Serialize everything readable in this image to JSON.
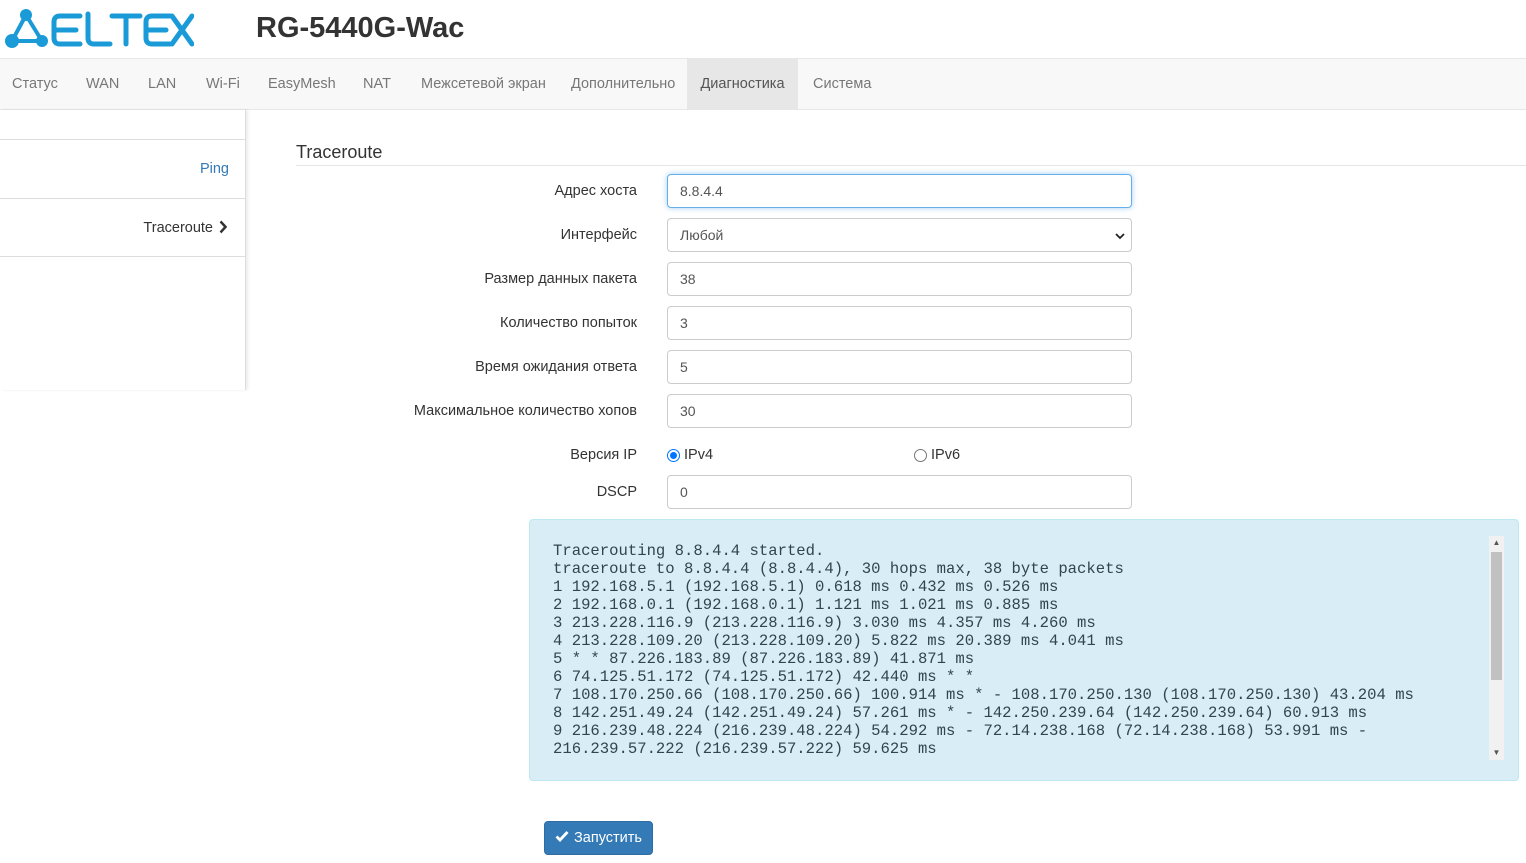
{
  "header": {
    "logo_text": "ELTEX",
    "model": "RG-5440G-Wac"
  },
  "nav": {
    "items": [
      "Статус",
      "WAN",
      "LAN",
      "Wi-Fi",
      "EasyMesh",
      "NAT",
      "Межсетевой экран",
      "Дополнительно",
      "Диагностика",
      "Система"
    ],
    "active": "Диагностика"
  },
  "side": {
    "items": [
      {
        "label": "Ping"
      },
      {
        "label": "Traceroute"
      }
    ],
    "current": "Traceroute",
    "current_icon": "chevron-right-icon"
  },
  "form": {
    "title": "Traceroute",
    "host_label": "Адрес хоста",
    "host_value": "8.8.4.4",
    "interface_label": "Интерфейс",
    "interface_value": "Любой",
    "packet_size_label": "Размер данных пакета",
    "packet_size_value": "38",
    "attempts_label": "Количество попыток",
    "attempts_value": "3",
    "timeout_label": "Время ожидания ответа",
    "timeout_value": "5",
    "max_hops_label": "Максимальное количество хопов",
    "max_hops_value": "30",
    "ip_version_label": "Версия IP",
    "ipv4_label": "IPv4",
    "ipv6_label": "IPv6",
    "ip_version_selected": "IPv4",
    "dscp_label": "DSCP",
    "dscp_value": "0"
  },
  "output": {
    "lines": [
      "Tracerouting 8.8.4.4 started.",
      "traceroute to 8.8.4.4 (8.8.4.4), 30 hops max, 38 byte packets",
      "1 192.168.5.1 (192.168.5.1) 0.618 ms 0.432 ms 0.526 ms",
      "2 192.168.0.1 (192.168.0.1) 1.121 ms 1.021 ms 0.885 ms",
      "3 213.228.116.9 (213.228.116.9) 3.030 ms 4.357 ms 4.260 ms",
      "4 213.228.109.20 (213.228.109.20) 5.822 ms 20.389 ms 4.041 ms",
      "5 * * 87.226.183.89 (87.226.183.89) 41.871 ms",
      "6 74.125.51.172 (74.125.51.172) 42.440 ms * *",
      "7 108.170.250.66 (108.170.250.66) 100.914 ms * - 108.170.250.130 (108.170.250.130) 43.204 ms",
      "8 142.251.49.24 (142.251.49.24) 57.261 ms * - 142.250.239.64 (142.250.239.64) 60.913 ms",
      "9 216.239.48.224 (216.239.48.224) 54.292 ms - 72.14.238.168 (72.14.238.168) 53.991 ms -",
      "216.239.57.222 (216.239.57.222) 59.625 ms"
    ]
  },
  "actions": {
    "run_label": "Запустить",
    "run_icon": "check-icon"
  },
  "colors": {
    "brand": "#1a9bd7",
    "primary": "#337ab7",
    "output_bg": "#d9edf7"
  }
}
